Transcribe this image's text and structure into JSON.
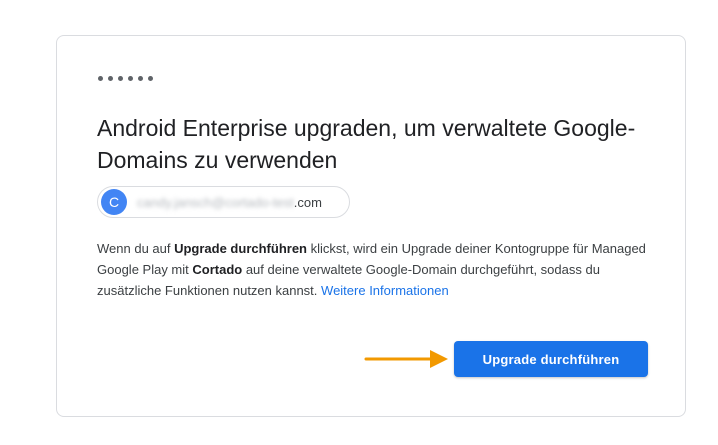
{
  "dialog": {
    "title": "Android Enterprise upgraden, um verwaltete Google-Domains zu verwenden",
    "account": {
      "avatar_letter": "C",
      "email_redacted": "candy.jansch@cortado-test",
      "email_domain": ".com"
    },
    "description": {
      "part1": "Wenn du auf ",
      "bold1": "Upgrade durchführen",
      "part2": " klickst, wird ein Upgrade deiner Kontogruppe für Managed Google Play mit ",
      "bold2": "Cortado",
      "part3": " auf deine verwaltete Google-Domain durchgeführt, sodass du zusätzliche Funktionen nutzen kannst. ",
      "link": "Weitere Informationen"
    },
    "primary_button_label": "Upgrade durchführen"
  },
  "colors": {
    "accent": "#1a73e8",
    "avatar": "#4285f4",
    "annotation_arrow": "#f29900"
  },
  "icons": {
    "progress": "loading-dots-icon",
    "annotation": "arrow-right-icon"
  }
}
